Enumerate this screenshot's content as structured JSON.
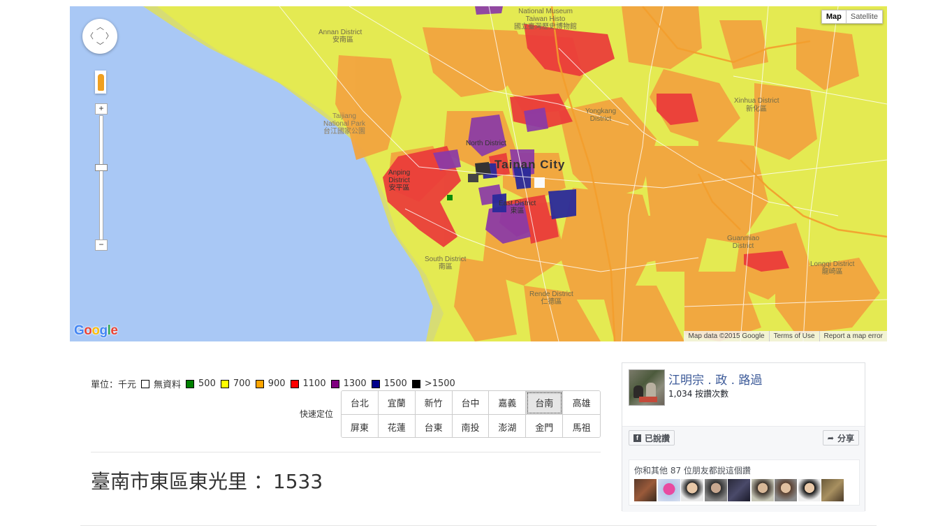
{
  "map": {
    "type_buttons": [
      "Map",
      "Satellite"
    ],
    "active_type": "Map",
    "zoom_in": "+",
    "zoom_out": "−",
    "google_logo": "Google",
    "footer": [
      "Map data ©2015 Google",
      "Terms of Use",
      "Report a map error"
    ],
    "labels": {
      "anan": "Annan District",
      "anan_zh": "安南區",
      "museum": "National Museum\nTaiwan Histo\n國立臺灣歷史博物館",
      "taijiang": "Taijiang\nNational Park\n台江國家公園",
      "north": "North District",
      "tainan": "Tainan City",
      "anping": "Anping\nDistrict\n安平區",
      "east": "East District\n東區",
      "south": "South District\n南區",
      "yongkang": "Yongkang\nDistrict",
      "xinhua": "Xinhua District",
      "xinhua_zh": "新化區",
      "guanmiao": "Guanmiao\nDistrict",
      "longqi": "Longqi District\n龍崎區",
      "rende": "Rende District\n仁德區"
    }
  },
  "legend": {
    "unit_label": "單位：千元",
    "items": [
      {
        "label": "無資料",
        "color": "#ffffff"
      },
      {
        "label": "500",
        "color": "#008000"
      },
      {
        "label": "700",
        "color": "#ffff00"
      },
      {
        "label": "900",
        "color": "#ffa500"
      },
      {
        "label": "1100",
        "color": "#ff0000"
      },
      {
        "label": "1300",
        "color": "#800080"
      },
      {
        "label": "1500",
        "color": "#00008b"
      },
      {
        "label": ">1500",
        "color": "#000000"
      }
    ]
  },
  "quick_locate": {
    "label": "快速定位",
    "cities": [
      "台北",
      "宜蘭",
      "新竹",
      "台中",
      "嘉義",
      "台南",
      "高雄",
      "屏東",
      "花蓮",
      "台東",
      "南投",
      "澎湖",
      "金門",
      "馬祖"
    ],
    "active": "台南"
  },
  "result": {
    "text": "臺南市東區東光里 ：1533"
  },
  "facebook": {
    "page_name": "江明宗 . 政 . 路過",
    "count": "1,034 按讚次數",
    "like_button": "已說讚",
    "share_button": "分享",
    "friends_text": "你和其他 87 位朋友都說這個讚",
    "icons": [
      "facebook-f-icon",
      "share-arrow-icon"
    ]
  }
}
